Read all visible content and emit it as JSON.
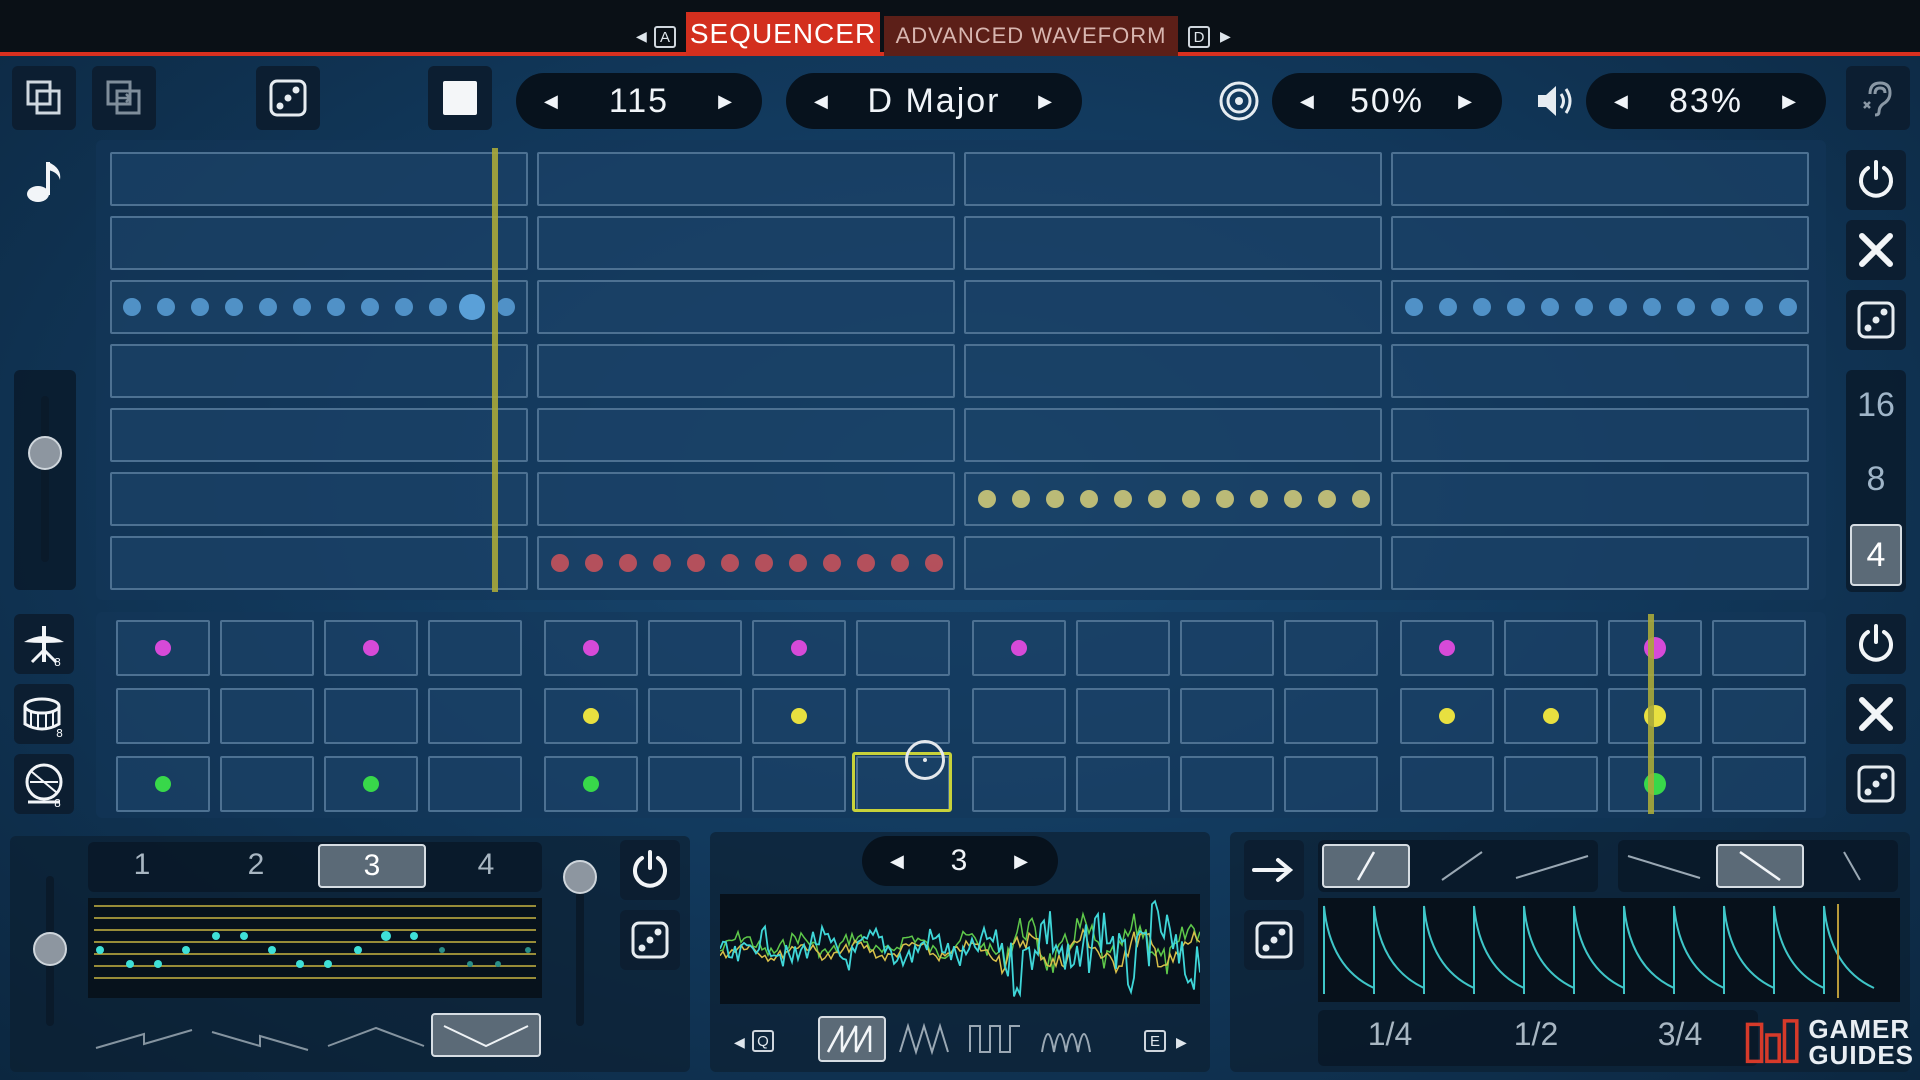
{
  "tabs": {
    "left_key": "A",
    "right_key": "D",
    "active": "SEQUENCER",
    "inactive": "ADVANCED WAVEFORM"
  },
  "toolbar": {
    "tempo": "115",
    "key": "D Major",
    "target_value": "50%",
    "volume_value": "83%"
  },
  "side_numbers": [
    "16",
    "8",
    "4"
  ],
  "selected_step_count": "4",
  "pattern_tabs": [
    "1",
    "2",
    "3",
    "4"
  ],
  "selected_pattern": "3",
  "waveform_index": "3",
  "wave_keys": {
    "left": "Q",
    "right": "E"
  },
  "rate_labels": [
    "1/4",
    "1/2",
    "3/4"
  ],
  "watermark": {
    "line1": "GAMER",
    "line2": "GUIDES"
  },
  "colors": {
    "accent_red": "#d32f1e",
    "note_blue": "#5aa0d8",
    "note_yellow": "#d8d07a",
    "note_red": "#d0545a",
    "drum_magenta": "#d64ad8",
    "drum_yellow": "#e8e040",
    "drum_green": "#38d84a",
    "playhead": "#a8a83a"
  },
  "icons": {
    "copy": "copy-icon",
    "paste": "paste-icon",
    "random": "dice-icon",
    "stop": "stop-icon",
    "target": "target-icon",
    "volume": "speaker-icon",
    "audio": "ear-icon",
    "note": "music-note-icon",
    "power": "power-icon",
    "clear": "close-icon",
    "cymbal": "cymbal-icon",
    "snare": "snare-icon",
    "kick": "kick-drum-icon",
    "arrow": "arrow-right-icon"
  }
}
